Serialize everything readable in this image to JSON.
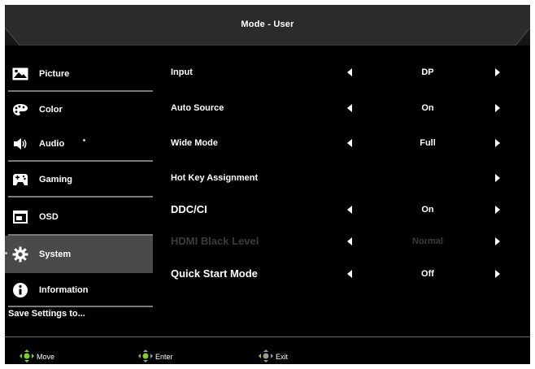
{
  "header": {
    "title": "Mode - User"
  },
  "sidebar": {
    "items": [
      {
        "label": "Picture",
        "icon": "picture-icon",
        "selected": false
      },
      {
        "label": "Color",
        "icon": "palette-icon",
        "selected": false
      },
      {
        "label": "Audio",
        "icon": "speaker-icon",
        "selected": false
      },
      {
        "label": "Gaming",
        "icon": "gamepad-icon",
        "selected": false
      },
      {
        "label": "OSD",
        "icon": "osd-window-icon",
        "selected": false
      },
      {
        "label": "System",
        "icon": "gear-icon",
        "selected": true
      },
      {
        "label": "Information",
        "icon": "info-icon",
        "selected": false
      }
    ],
    "save_settings": "Save Settings to..."
  },
  "menu": {
    "rows": [
      {
        "label": "Input",
        "value": "DP",
        "left_arrow": true,
        "right_arrow": true,
        "enabled": true
      },
      {
        "label": "Auto Source",
        "value": "On",
        "left_arrow": true,
        "right_arrow": true,
        "enabled": true
      },
      {
        "label": "Wide Mode",
        "value": "Full",
        "left_arrow": true,
        "right_arrow": true,
        "enabled": true
      },
      {
        "label": "Hot Key Assignment",
        "value": "",
        "left_arrow": false,
        "right_arrow": true,
        "enabled": true
      },
      {
        "label": "DDC/CI",
        "value": "On",
        "left_arrow": true,
        "right_arrow": true,
        "enabled": true
      },
      {
        "label": "HDMI Black Level",
        "value": "Normal",
        "left_arrow": true,
        "right_arrow": true,
        "enabled": false
      },
      {
        "label": "Quick Start Mode",
        "value": "Off",
        "left_arrow": true,
        "right_arrow": true,
        "enabled": true
      }
    ]
  },
  "footer": {
    "move": "Move",
    "enter": "Enter",
    "exit": "Exit"
  },
  "colors": {
    "background": "#000000",
    "selected": "#4a4a4a",
    "text": "#ffffff",
    "disabled_text": "#3c3c3c",
    "nav_green": "#7ed321"
  }
}
